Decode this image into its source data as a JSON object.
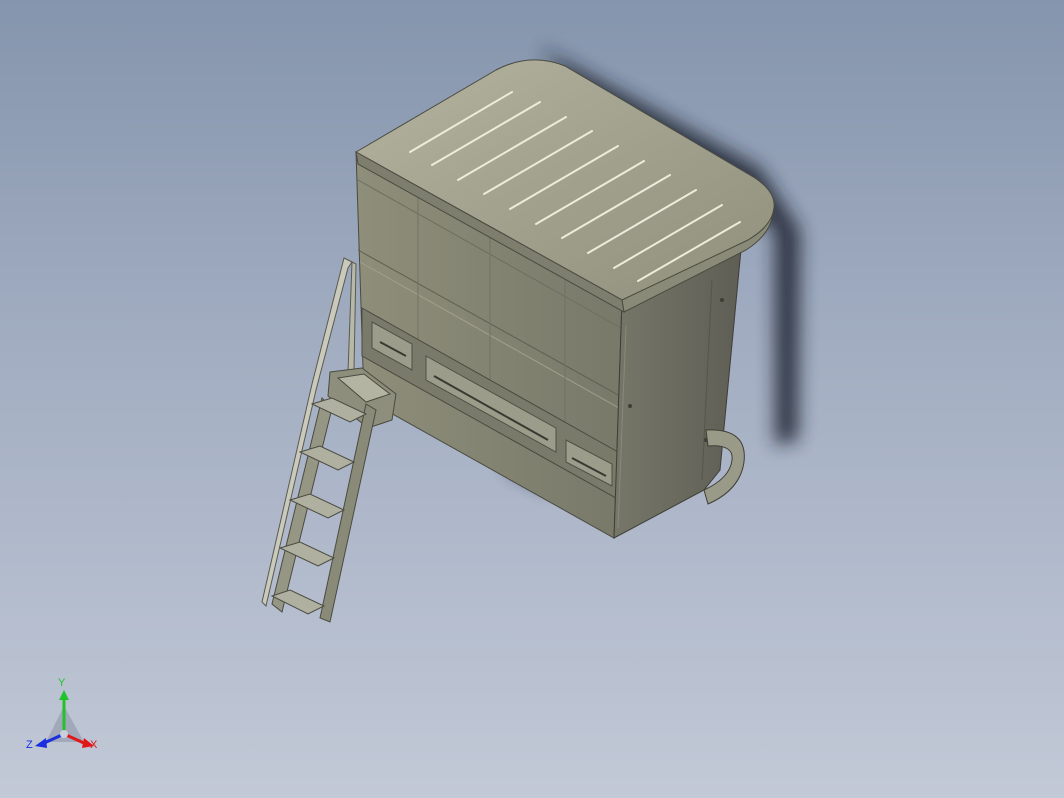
{
  "viewport": {
    "background_top": "#8595ad",
    "background_bottom": "#c2c9d7"
  },
  "model": {
    "body_color": "#8a8a76",
    "roof_color": "#a4a490",
    "side_color": "#6c6c60",
    "shadow_color": "#1c222e"
  },
  "triad": {
    "y_label": "Y",
    "x_label": "X",
    "z_label": "Z",
    "y_color": "#22c22a",
    "x_color": "#e01818",
    "z_color": "#1a2ee0"
  }
}
